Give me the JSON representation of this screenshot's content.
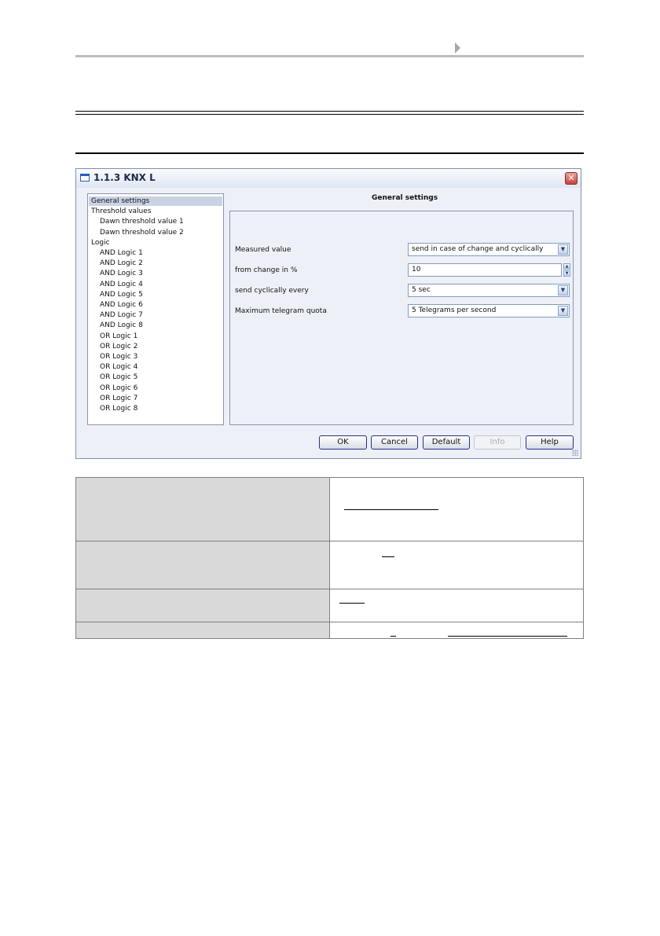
{
  "dialog": {
    "title": "1.1.3 KNX L",
    "close_glyph": "✕"
  },
  "tree": {
    "items": [
      {
        "label": "General settings",
        "level": 0,
        "selected": true
      },
      {
        "label": "Threshold values",
        "level": 0
      },
      {
        "label": "Dawn threshold value 1",
        "level": 1
      },
      {
        "label": "Dawn threshold value 2",
        "level": 1
      },
      {
        "label": "Logic",
        "level": 0
      },
      {
        "label": "AND Logic 1",
        "level": 1
      },
      {
        "label": "AND Logic 2",
        "level": 1
      },
      {
        "label": "AND Logic 3",
        "level": 1
      },
      {
        "label": "AND Logic 4",
        "level": 1
      },
      {
        "label": "AND Logic 5",
        "level": 1
      },
      {
        "label": "AND Logic 6",
        "level": 1
      },
      {
        "label": "AND Logic 7",
        "level": 1
      },
      {
        "label": "AND Logic 8",
        "level": 1
      },
      {
        "label": "OR Logic 1",
        "level": 1
      },
      {
        "label": "OR Logic 2",
        "level": 1
      },
      {
        "label": "OR Logic 3",
        "level": 1
      },
      {
        "label": "OR Logic 4",
        "level": 1
      },
      {
        "label": "OR Logic 5",
        "level": 1
      },
      {
        "label": "OR Logic 6",
        "level": 1
      },
      {
        "label": "OR Logic 7",
        "level": 1
      },
      {
        "label": "OR Logic 8",
        "level": 1
      }
    ]
  },
  "panel": {
    "title": "General settings",
    "params": [
      {
        "label": "Measured value",
        "value": "send in case of change and cyclically",
        "control": "dropdown"
      },
      {
        "label": "from change in %",
        "value": "10",
        "control": "spinner"
      },
      {
        "label": "send cyclically every",
        "value": "5 sec",
        "control": "dropdown"
      },
      {
        "label": "Maximum telegram quota",
        "value": "5 Telegrams per second",
        "control": "dropdown"
      }
    ]
  },
  "buttons": {
    "ok": "OK",
    "cancel": "Cancel",
    "default": "Default",
    "info": "Info",
    "help": "Help"
  },
  "colors": {
    "accent_border": "#25318a",
    "tree_selection": "#c9d3e4",
    "table_label_fill": "#d9d9d9"
  }
}
